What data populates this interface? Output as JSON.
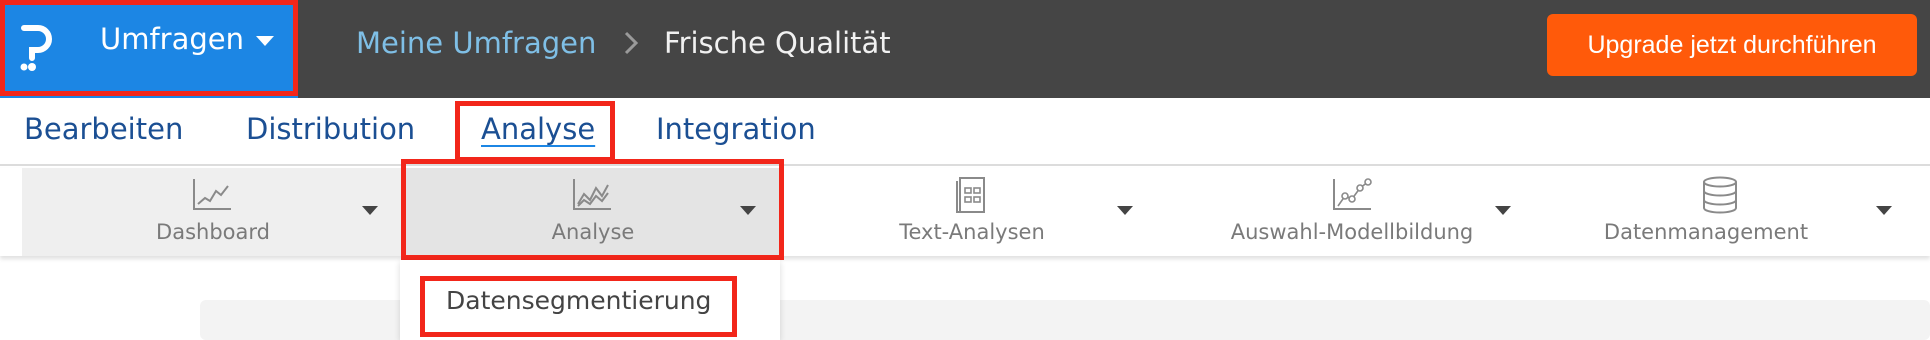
{
  "topbar": {
    "app_name": "Umfragen",
    "breadcrumb": {
      "parent": "Meine Umfragen",
      "current": "Frische Qualität"
    },
    "upgrade_label": "Upgrade jetzt durchführen"
  },
  "nav": {
    "items": [
      {
        "label": "Bearbeiten"
      },
      {
        "label": "Distribution"
      },
      {
        "label": "Analyse"
      },
      {
        "label": "Integration"
      }
    ],
    "active": "Analyse"
  },
  "toolbar": {
    "tools": [
      {
        "label": "Dashboard",
        "icon": "line-chart-icon"
      },
      {
        "label": "Analyse",
        "icon": "area-chart-icon"
      },
      {
        "label": "Text-Analysen",
        "icon": "document-grid-icon"
      },
      {
        "label": "Auswahl-Modellbildung",
        "icon": "scatter-chart-icon"
      },
      {
        "label": "Datenmanagement",
        "icon": "database-icon"
      }
    ]
  },
  "dropdown": {
    "items": [
      {
        "label": "Datensegmentierung"
      }
    ]
  },
  "colors": {
    "brand_blue": "#1c86e4",
    "upgrade_orange": "#ff5a0a",
    "topbar_bg": "#454545",
    "highlight_red": "#f2261a",
    "nav_text": "#1b4f93"
  }
}
